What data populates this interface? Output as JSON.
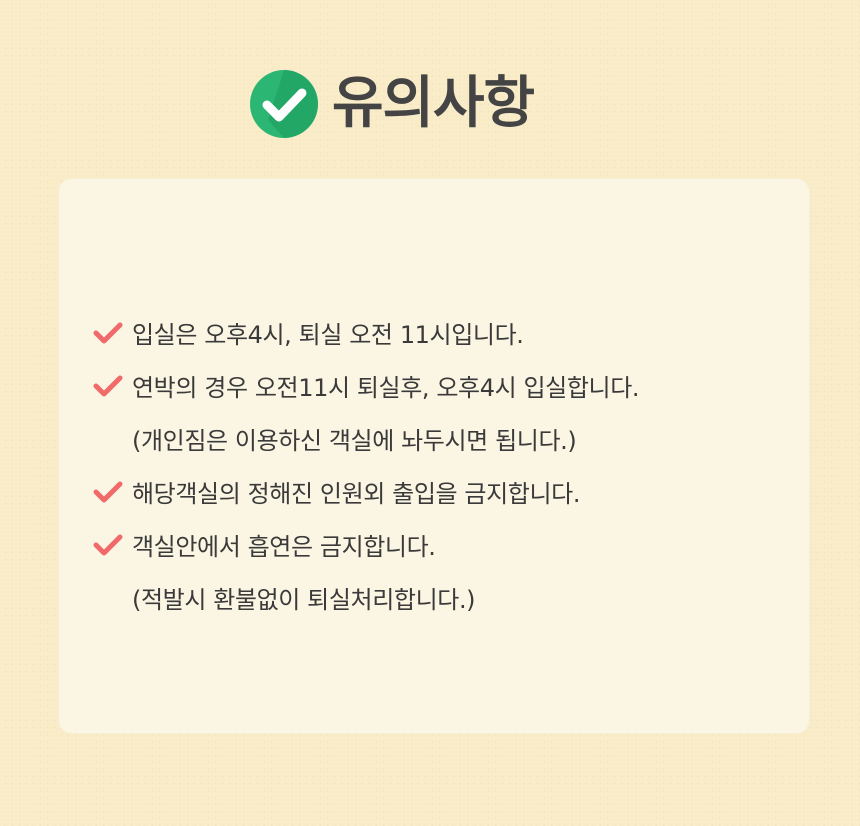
{
  "title": {
    "icon": "check-circle-icon",
    "text": "유의사항",
    "icon_color": "#2bb673",
    "icon_shadow_color": "#1c9a5c"
  },
  "notes": {
    "check_icon": "checkmark-icon",
    "check_color": "#f06a6a",
    "items": [
      {
        "text": "입실은 오후4시, 퇴실 오전 11시입니다.",
        "has_check": true
      },
      {
        "text": "연박의 경우 오전11시 퇴실후, 오후4시 입실합니다.",
        "has_check": true
      },
      {
        "text": "(개인짐은 이용하신 객실에 놔두시면 됩니다.)",
        "has_check": false
      },
      {
        "text": "해당객실의 정해진 인원외 출입을 금지합니다.",
        "has_check": true
      },
      {
        "text": "객실안에서 흡연은 금지합니다.",
        "has_check": true
      },
      {
        "text": "(적발시 환불없이 퇴실처리합니다.)",
        "has_check": false
      }
    ]
  }
}
